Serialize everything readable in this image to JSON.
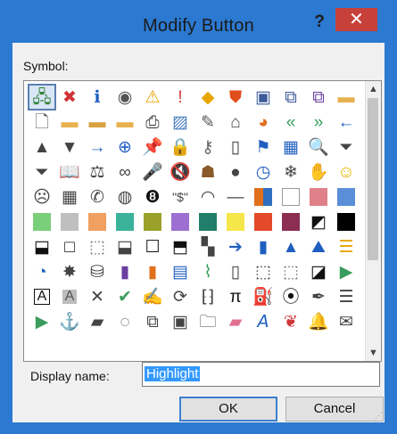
{
  "dialog": {
    "title": "Modify Button",
    "help_label": "?",
    "close_label": "✕"
  },
  "symbol_label": "Symbol:",
  "symbols": [
    {
      "name": "org-chart-icon",
      "glyph": "🖧",
      "color": "#2e7d32",
      "selected": true
    },
    {
      "name": "error-icon",
      "glyph": "✖",
      "color": "#d13438"
    },
    {
      "name": "info-icon",
      "glyph": "ℹ",
      "color": "#1f5fbf"
    },
    {
      "name": "record-icon",
      "glyph": "◉",
      "color": "#555555"
    },
    {
      "name": "warning-icon",
      "glyph": "⚠",
      "color": "#e8a400"
    },
    {
      "name": "exclamation-icon",
      "glyph": "!",
      "color": "#d13438"
    },
    {
      "name": "diamond-warning-icon",
      "glyph": "◆",
      "color": "#e8a400"
    },
    {
      "name": "shield-icon",
      "glyph": "⛊",
      "color": "#e04e1b"
    },
    {
      "name": "save-icon",
      "glyph": "▣",
      "color": "#3b5a9a"
    },
    {
      "name": "save-all-icon",
      "glyph": "⧉",
      "color": "#3b5a9a"
    },
    {
      "name": "save-as-icon",
      "glyph": "⧉",
      "color": "#6a3fa0"
    },
    {
      "name": "folder-icon",
      "glyph": "▬",
      "color": "#e8b14f"
    },
    {
      "name": "new-document-icon",
      "glyph": "🗋",
      "color": "#555555"
    },
    {
      "name": "open-folder-icon",
      "glyph": "▬",
      "color": "#e8b14f"
    },
    {
      "name": "folder-open-icon",
      "glyph": "▬",
      "color": "#d8a03f"
    },
    {
      "name": "folder-move-icon",
      "glyph": "▬",
      "color": "#e8b14f"
    },
    {
      "name": "print-icon",
      "glyph": "⎙",
      "color": "#333333"
    },
    {
      "name": "picture-icon",
      "glyph": "▨",
      "color": "#4a7dbf"
    },
    {
      "name": "document-edit-icon",
      "glyph": "✎",
      "color": "#555555"
    },
    {
      "name": "home-icon",
      "glyph": "⌂",
      "color": "#444444"
    },
    {
      "name": "pie-chart-icon",
      "glyph": "◕",
      "color": "#e06c1f"
    },
    {
      "name": "rewind-icon",
      "glyph": "«",
      "color": "#3a9d5d"
    },
    {
      "name": "fast-forward-icon",
      "glyph": "»",
      "color": "#3a9d5d"
    },
    {
      "name": "back-arrow-icon",
      "glyph": "←",
      "color": "#1f5fbf"
    },
    {
      "name": "triangle-up-icon",
      "glyph": "▲",
      "color": "#444444"
    },
    {
      "name": "triangle-down-icon",
      "glyph": "▼",
      "color": "#444444"
    },
    {
      "name": "arrow-right-icon",
      "glyph": "→",
      "color": "#1f5fbf"
    },
    {
      "name": "circle-back-icon",
      "glyph": "⊕",
      "color": "#1f5fbf"
    },
    {
      "name": "pin-icon",
      "glyph": "📌",
      "color": "#444444"
    },
    {
      "name": "lock-icon",
      "glyph": "🔒",
      "color": "#d8a03f"
    },
    {
      "name": "key-icon",
      "glyph": "⚷",
      "color": "#666666"
    },
    {
      "name": "page-icon",
      "glyph": "▯",
      "color": "#444444"
    },
    {
      "name": "flag-icon",
      "glyph": "⚑",
      "color": "#1f5fbf"
    },
    {
      "name": "calendar-icon",
      "glyph": "▦",
      "color": "#1f5fbf"
    },
    {
      "name": "search-icon",
      "glyph": "🔍",
      "color": "#444444"
    },
    {
      "name": "filter-icon",
      "glyph": "⏷",
      "color": "#444444"
    },
    {
      "name": "funnel-icon",
      "glyph": "⏷",
      "color": "#444444"
    },
    {
      "name": "book-icon",
      "glyph": "📖",
      "color": "#1f5fbf"
    },
    {
      "name": "scales-icon",
      "glyph": "⚖",
      "color": "#444444"
    },
    {
      "name": "link-icon",
      "glyph": "∞",
      "color": "#444444"
    },
    {
      "name": "microphone-icon",
      "glyph": "🎤",
      "color": "#1f5fbf"
    },
    {
      "name": "mute-icon",
      "glyph": "🔇",
      "color": "#444444"
    },
    {
      "name": "person-icon",
      "glyph": "☗",
      "color": "#8a5a2b"
    },
    {
      "name": "user-icon",
      "glyph": "●",
      "color": "#444444"
    },
    {
      "name": "clock-icon",
      "glyph": "◷",
      "color": "#1f5fbf"
    },
    {
      "name": "snowflake-icon",
      "glyph": "❄",
      "color": "#444444"
    },
    {
      "name": "hand-icon",
      "glyph": "✋",
      "color": "#444444"
    },
    {
      "name": "smiley-icon",
      "glyph": "☺",
      "color": "#e8b400"
    },
    {
      "name": "sad-face-icon",
      "glyph": "☹",
      "color": "#444444"
    },
    {
      "name": "calculator-icon",
      "glyph": "▦",
      "color": "#444444"
    },
    {
      "name": "phone-icon",
      "glyph": "✆",
      "color": "#444444"
    },
    {
      "name": "piggy-bank-icon",
      "glyph": "◍",
      "color": "#444444"
    },
    {
      "name": "eight-ball-icon",
      "glyph": "❽",
      "color": "#111111"
    },
    {
      "name": "dollar-sign-icon",
      "glyph": "\"$\"",
      "color": "#444444"
    },
    {
      "name": "eye-icon",
      "glyph": "◠",
      "color": "#444444"
    },
    {
      "name": "dash-icon",
      "glyph": "—",
      "color": "#444444"
    },
    {
      "name": "color-grid-icon",
      "swatch": "#e0701c",
      "grid": true
    },
    {
      "name": "white-square-icon",
      "swatch": "#ffffff",
      "border": true
    },
    {
      "name": "pink-square-icon",
      "swatch": "#e08088"
    },
    {
      "name": "blue-square-icon",
      "swatch": "#5a8fd8"
    },
    {
      "name": "green-square-icon",
      "swatch": "#7acf7a"
    },
    {
      "name": "gray-square-icon",
      "swatch": "#bfbfbf"
    },
    {
      "name": "orange-square-icon",
      "swatch": "#f0a060"
    },
    {
      "name": "teal-square-icon",
      "swatch": "#3bb39a"
    },
    {
      "name": "olive-square-icon",
      "swatch": "#9aa12b"
    },
    {
      "name": "purple-square-icon",
      "swatch": "#9c6fd0"
    },
    {
      "name": "dark-teal-square-icon",
      "swatch": "#1f7f6a"
    },
    {
      "name": "yellow-square-icon",
      "swatch": "#f5e64a"
    },
    {
      "name": "red-orange-square-icon",
      "swatch": "#e24a2a"
    },
    {
      "name": "maroon-square-icon",
      "swatch": "#8c2d52"
    },
    {
      "name": "half-black-square-icon",
      "glyph": "◩",
      "color": "#111111"
    },
    {
      "name": "black-square-icon",
      "swatch": "#000000"
    },
    {
      "name": "bottom-bar-square-icon",
      "glyph": "⬓",
      "color": "#111111"
    },
    {
      "name": "bold-border-square-icon",
      "glyph": "□",
      "color": "#111111"
    },
    {
      "name": "dotted-square-icon",
      "glyph": "⬚",
      "color": "#777777"
    },
    {
      "name": "mid-bar-square-icon",
      "glyph": "⬓",
      "color": "#444444"
    },
    {
      "name": "outline-square-icon",
      "glyph": "☐",
      "color": "#111111"
    },
    {
      "name": "top-bar-square-icon",
      "glyph": "⬒",
      "color": "#111111"
    },
    {
      "name": "checker-square-icon",
      "glyph": "▚",
      "color": "#444444"
    },
    {
      "name": "circle-arrow-icon",
      "glyph": "➔",
      "color": "#1f5fbf"
    },
    {
      "name": "bar-chart-icon",
      "glyph": "▮",
      "color": "#1f5fbf"
    },
    {
      "name": "pyramid-icon",
      "glyph": "▲",
      "color": "#1f5fbf"
    },
    {
      "name": "mountain-icon",
      "glyph": "⛰",
      "color": "#1f5fbf"
    },
    {
      "name": "hbar-chart-icon",
      "glyph": "☰",
      "color": "#e8a400"
    },
    {
      "name": "pie-icon",
      "glyph": "◔",
      "color": "#1f5fbf"
    },
    {
      "name": "spider-web-icon",
      "glyph": "✸",
      "color": "#444444"
    },
    {
      "name": "database-icon",
      "glyph": "⛁",
      "color": "#444444"
    },
    {
      "name": "purple-book-icon",
      "glyph": "▮",
      "color": "#6a3fa0"
    },
    {
      "name": "orange-book-icon",
      "glyph": "▮",
      "color": "#e0701c"
    },
    {
      "name": "chart-picture-icon",
      "glyph": "▤",
      "color": "#1f5fbf"
    },
    {
      "name": "line-chart-icon",
      "glyph": "⌇",
      "color": "#3a9d5d"
    },
    {
      "name": "blank-page-icon",
      "glyph": "▯",
      "color": "#444444"
    },
    {
      "name": "dotted-page-icon",
      "glyph": "⬚",
      "color": "#444444"
    },
    {
      "name": "dotted-frame-icon",
      "glyph": "⬚",
      "color": "#777777"
    },
    {
      "name": "diagonal-square-icon",
      "glyph": "◪",
      "color": "#111111"
    },
    {
      "name": "triangle-flag-icon",
      "glyph": "▶",
      "color": "#3a9d5d"
    },
    {
      "name": "text-box-icon",
      "glyph": "A",
      "color": "#111111",
      "boxed": true
    },
    {
      "name": "gray-text-icon",
      "glyph": "A",
      "color": "#555555",
      "shaded": true
    },
    {
      "name": "cross-icon",
      "glyph": "✕",
      "color": "#444444"
    },
    {
      "name": "check-icon",
      "glyph": "✔",
      "color": "#3a9d5d"
    },
    {
      "name": "chart-edit-icon",
      "glyph": "✍",
      "color": "#1f5fbf"
    },
    {
      "name": "refresh-icon",
      "glyph": "⟳",
      "color": "#444444"
    },
    {
      "name": "brackets-icon",
      "glyph": "⁅⁆",
      "color": "#444444"
    },
    {
      "name": "pi-icon",
      "glyph": "π",
      "color": "#111111"
    },
    {
      "name": "paint-bucket-icon",
      "glyph": "⛽",
      "color": "#e8a400"
    },
    {
      "name": "binoculars-icon",
      "glyph": "⦿",
      "color": "#111111"
    },
    {
      "name": "magic-wand-icon",
      "glyph": "✒",
      "color": "#444444"
    },
    {
      "name": "bullet-list-icon",
      "glyph": "☰",
      "color": "#444444"
    },
    {
      "name": "play-icon",
      "glyph": "▶",
      "color": "#3a9d5d"
    },
    {
      "name": "anchor-icon",
      "glyph": "⚓",
      "color": "#444444"
    },
    {
      "name": "toolbox-icon",
      "glyph": "▰",
      "color": "#444444"
    },
    {
      "name": "lasso-icon",
      "glyph": "◌",
      "color": "#444444"
    },
    {
      "name": "copy-icon",
      "glyph": "⧉",
      "color": "#444444"
    },
    {
      "name": "portrait-icon",
      "glyph": "▣",
      "color": "#444444"
    },
    {
      "name": "folder-outline-icon",
      "glyph": "🗀",
      "color": "#444444"
    },
    {
      "name": "eraser-icon",
      "glyph": "▰",
      "color": "#e07090"
    },
    {
      "name": "letter-a-icon",
      "glyph": "𝘈",
      "color": "#1f5fbf"
    },
    {
      "name": "butterfly-icon",
      "glyph": "❦",
      "color": "#d13438"
    },
    {
      "name": "bell-icon",
      "glyph": "🔔",
      "color": "#e8a400"
    },
    {
      "name": "envelope-open-icon",
      "glyph": "✉",
      "color": "#444444"
    }
  ],
  "display_name_label": "Display name:",
  "display_name_value": "Highlight",
  "ok_label": "OK",
  "cancel_label": "Cancel"
}
